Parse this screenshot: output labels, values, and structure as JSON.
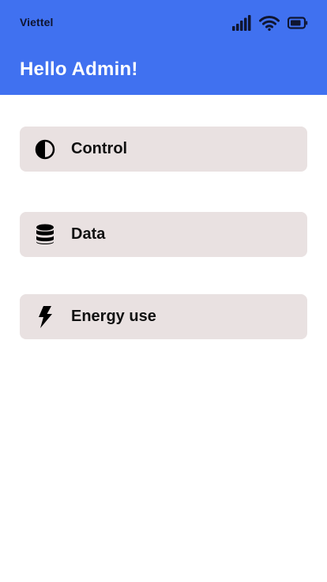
{
  "status_bar": {
    "carrier": "Viettel",
    "icons": [
      "signal-bars-icon",
      "wifi-icon",
      "battery-icon"
    ]
  },
  "header": {
    "title": "Hello Admin!",
    "background_color": "#4071f0"
  },
  "menu": {
    "item_background_color": "#e9e1e1",
    "items": [
      {
        "label": "Control",
        "icon": "contrast-icon"
      },
      {
        "label": "Data",
        "icon": "database-icon"
      },
      {
        "label": "Energy use",
        "icon": "lightning-bolt-icon"
      }
    ]
  }
}
